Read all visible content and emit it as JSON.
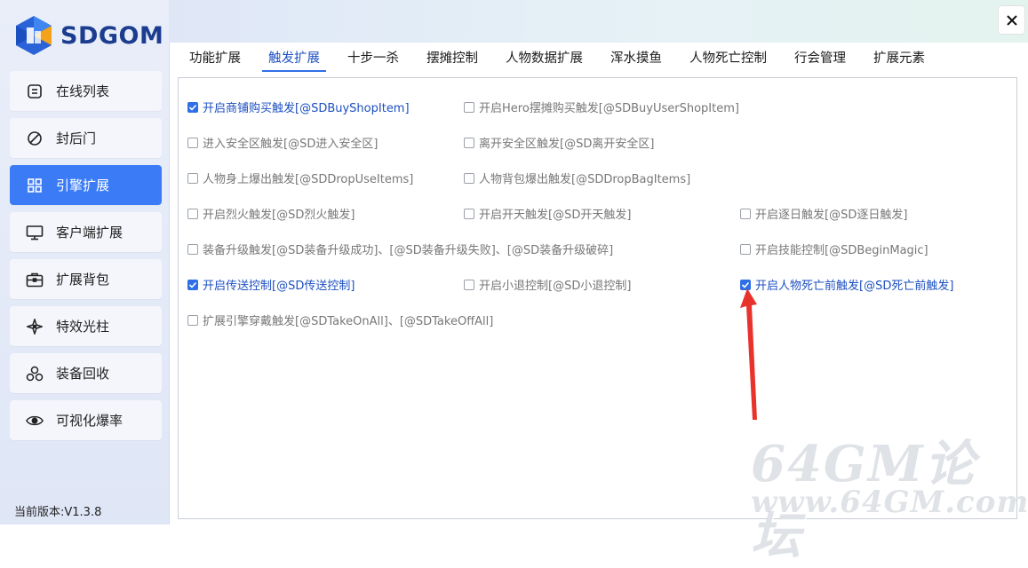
{
  "app": {
    "logo_text": "SDGOM",
    "version": "当前版本:V1.3.8"
  },
  "sidebar": {
    "items": [
      {
        "label": "在线列表",
        "icon": "list-icon",
        "active": false
      },
      {
        "label": "封后门",
        "icon": "ban-icon",
        "active": false
      },
      {
        "label": "引擎扩展",
        "icon": "grid-icon",
        "active": true
      },
      {
        "label": "客户端扩展",
        "icon": "monitor-icon",
        "active": false
      },
      {
        "label": "扩展背包",
        "icon": "briefcase-icon",
        "active": false
      },
      {
        "label": "特效光柱",
        "icon": "sparkle-icon",
        "active": false
      },
      {
        "label": "装备回收",
        "icon": "recycle-icon",
        "active": false
      },
      {
        "label": "可视化爆率",
        "icon": "eye-icon",
        "active": false
      }
    ]
  },
  "tabs": [
    {
      "label": "功能扩展",
      "active": false
    },
    {
      "label": "触发扩展",
      "active": true
    },
    {
      "label": "十步一杀",
      "active": false
    },
    {
      "label": "摆摊控制",
      "active": false
    },
    {
      "label": "人物数据扩展",
      "active": false
    },
    {
      "label": "浑水摸鱼",
      "active": false
    },
    {
      "label": "人物死亡控制",
      "active": false
    },
    {
      "label": "行会管理",
      "active": false
    },
    {
      "label": "扩展元素",
      "active": false
    }
  ],
  "options": [
    {
      "label": "开启商铺购买触发[@SDBuyShopItem]",
      "checked": true
    },
    {
      "label": "开启Hero摆摊购买触发[@SDBuyUserShopItem]",
      "checked": false
    },
    {
      "label": "进入安全区触发[@SD进入安全区]",
      "checked": false
    },
    {
      "label": "离开安全区触发[@SD离开安全区]",
      "checked": false
    },
    {
      "label": "人物身上爆出触发[@SDDropUseItems]",
      "checked": false
    },
    {
      "label": "人物背包爆出触发[@SDDropBagItems]",
      "checked": false
    },
    {
      "label": "开启烈火触发[@SD烈火触发]",
      "checked": false
    },
    {
      "label": "开启开天触发[@SD开天触发]",
      "checked": false
    },
    {
      "label": "开启逐日触发[@SD逐日触发]",
      "checked": false
    },
    {
      "label": "装备升级触发[@SD装备升级成功]、[@SD装备升级失败]、[@SD装备升级破碎]",
      "checked": false
    },
    {
      "label": "开启技能控制[@SDBeginMagic]",
      "checked": false
    },
    {
      "label": "开启传送控制[@SD传送控制]",
      "checked": true
    },
    {
      "label": "开启小退控制[@SD小退控制]",
      "checked": false
    },
    {
      "label": "开启人物死亡前触发[@SD死亡前触发]",
      "checked": true
    },
    {
      "label": "扩展引擎穿戴触发[@SDTakeOnAll]、[@SDTakeOffAll]",
      "checked": false
    }
  ],
  "watermark": {
    "line1": "64GM论坛",
    "line2": "www.64GM.com"
  },
  "colors": {
    "accent": "#3b7cf6",
    "checked_text": "#1c4fc0",
    "annotation_arrow": "#e8332d"
  }
}
